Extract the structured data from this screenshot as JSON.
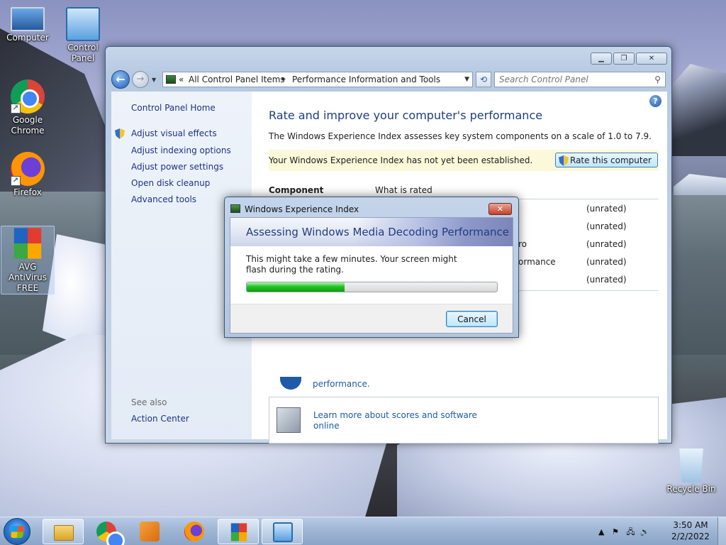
{
  "desktop": {
    "icons": [
      {
        "label": "Computer"
      },
      {
        "label": "Control Panel"
      },
      {
        "label": "Google Chrome"
      },
      {
        "label": "Firefox"
      },
      {
        "label": "AVG AntiVirus FREE"
      },
      {
        "label": "Recycle Bin"
      }
    ]
  },
  "window": {
    "breadcrumb": [
      "All Control Panel Items",
      "Performance Information and Tools"
    ],
    "crumb_separator": "▸",
    "history_prefix": "«",
    "search_placeholder": "Search Control Panel",
    "left_pane": {
      "home": "Control Panel Home",
      "links": [
        "Adjust visual effects",
        "Adjust indexing options",
        "Adjust power settings",
        "Open disk cleanup",
        "Advanced tools"
      ],
      "see_also_title": "See also",
      "see_also": [
        "Action Center"
      ]
    },
    "main": {
      "title": "Rate and improve your computer's performance",
      "description": "The Windows Experience Index assesses key system components on a scale of 1.0 to 7.9.",
      "notice": "Your Windows Experience Index has not yet been established.",
      "rate_button": "Rate this computer",
      "table": {
        "col_component": "Component",
        "col_what_rated": "What is rated",
        "scores": [
          "(unrated)",
          "(unrated)",
          "(unrated)",
          "(unrated)",
          "(unrated)"
        ],
        "row_fragments": [
          "ro",
          "ormance"
        ]
      },
      "partial_link": "performance.",
      "learn_more": "Learn more about scores and software online"
    }
  },
  "dialog": {
    "title": "Windows Experience Index",
    "heading": "Assessing Windows Media Decoding Performance",
    "message": "This might take a few minutes. Your screen might flash during the rating.",
    "progress": 0.39,
    "cancel": "Cancel"
  },
  "taskbar": {
    "time": "3:50 AM",
    "date": "2/2/2022"
  },
  "colors": {
    "link": "#1e3287",
    "title_blue": "#1e3d82",
    "progress_green": "#22c522",
    "notice_yellow": "#fbf9d9"
  }
}
